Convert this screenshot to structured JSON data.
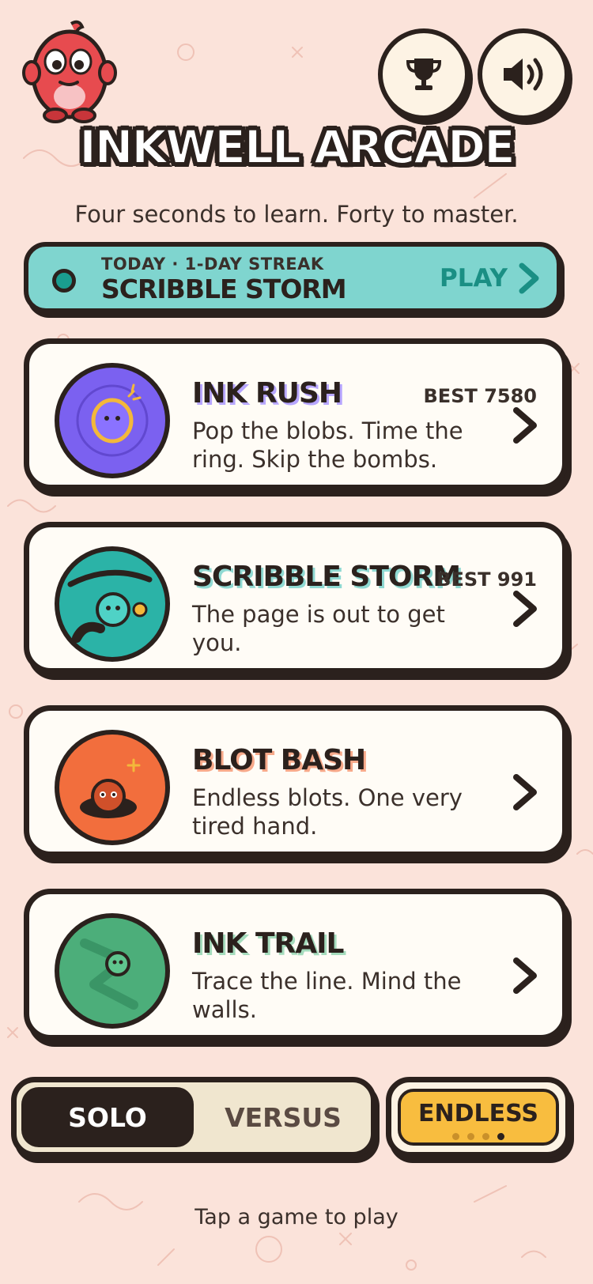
{
  "app": {
    "title": "INKWELL ARCADE",
    "tagline": "Four seconds to learn. Forty to master."
  },
  "header": {
    "mascot_icon": "blob-mascot",
    "trophy_icon": "trophy-icon",
    "sound_icon": "speaker-icon"
  },
  "daily": {
    "subtitle": "TODAY · 1-DAY STREAK",
    "title": "SCRIBBLE STORM",
    "play_label": "PLAY"
  },
  "games": [
    {
      "title": "INK RUSH",
      "best": "BEST 7580",
      "description": "Pop the blobs. Time the ring. Skip the bombs.",
      "color": "#7b61f0"
    },
    {
      "title": "SCRIBBLE STORM",
      "best": "BEST 991",
      "description": "The page is out to get you.",
      "color": "#2bb3a7"
    },
    {
      "title": "BLOT BASH",
      "best": "",
      "description": "Endless blots. One very tired hand.",
      "color": "#f26e3d"
    },
    {
      "title": "INK TRAIL",
      "best": "",
      "description": "Trace the line. Mind the walls.",
      "color": "#4cae7a"
    }
  ],
  "modes": {
    "solo": "SOLO",
    "versus": "VERSUS",
    "endless": "ENDLESS",
    "endless_page": 4,
    "endless_pages": 4
  },
  "footer": {
    "hint": "Tap a game to play"
  },
  "colors": {
    "background": "#fbe3da",
    "ink": "#2b211d",
    "daily_banner": "#7fd5cf",
    "endless": "#f8bd3f"
  }
}
